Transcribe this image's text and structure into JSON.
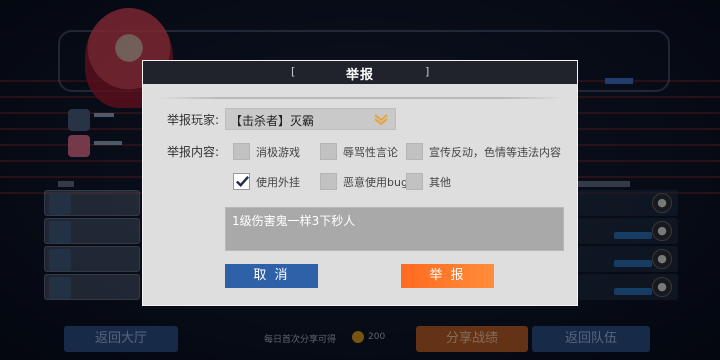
{
  "background": {
    "bottom_bar": {
      "lobby_button": "返回大厅",
      "share_hint": "每日首次分享可得",
      "coin_value": "200",
      "share_button": "分享战绩",
      "team_button": "返回队伍"
    }
  },
  "dialog": {
    "title": "举报",
    "bracket_left": "[",
    "bracket_right": "]",
    "player_label": "举报玩家:",
    "player_selected": "【击杀者】灭霸",
    "content_label": "举报内容:",
    "options": [
      {
        "label": "消极游戏",
        "checked": false
      },
      {
        "label": "辱骂性言论",
        "checked": false
      },
      {
        "label": "宣传反动，色情等违法内容",
        "checked": false
      },
      {
        "label": "使用外挂",
        "checked": true
      },
      {
        "label": "恶意使用bug",
        "checked": false
      },
      {
        "label": "其他",
        "checked": false
      }
    ],
    "reason_text": "1级伤害鬼一样3下秒人",
    "cancel_label": "取 消",
    "report_label": "举 报"
  },
  "colors": {
    "header_bg": "#20232c",
    "dialog_bg": "#dedede",
    "cancel_bg": "#2f61a9",
    "report_bg": "#ff6a1f",
    "arrow_accent": "#e8a23a"
  }
}
